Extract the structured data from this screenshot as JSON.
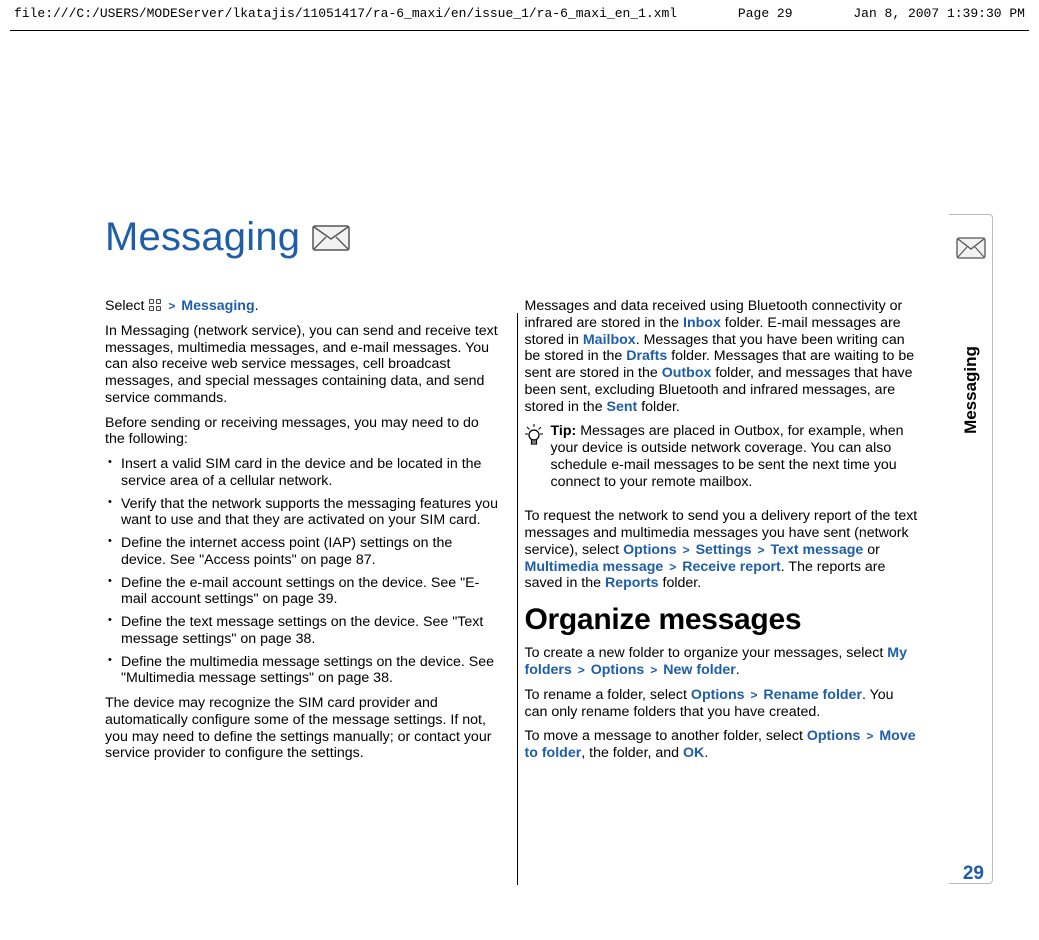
{
  "header": {
    "path": "file:///C:/USERS/MODEServer/lkatajis/11051417/ra-6_maxi/en/issue_1/ra-6_maxi_en_1.xml",
    "page": "Page 29",
    "timestamp": "Jan 8, 2007 1:39:30 PM"
  },
  "title": "Messaging",
  "side_tab": "Messaging",
  "page_number": "29",
  "colL": {
    "intro_prefix": "Select ",
    "intro_messaging": "Messaging",
    "p1": "In Messaging (network service), you can send and receive text messages, multimedia messages, and e-mail messages. You can also receive web service messages, cell broadcast messages, and special messages containing data, and send service commands.",
    "p2": "Before sending or receiving messages, you may need to do the following:",
    "li1": "Insert a valid SIM card in the device and be located in the service area of a cellular network.",
    "li2": "Verify that the network supports the messaging features you want to use and that they are activated on your SIM card.",
    "li3": "Define the internet access point (IAP) settings on the device. See \"Access points\" on page 87.",
    "li4": "Define the e-mail account settings on the device. See \"E-mail account settings\" on page 39.",
    "li5": "Define the text message settings on the device. See \"Text message settings\" on page 38.",
    "li6": "Define the multimedia message settings on the device. See \"Multimedia message settings\" on page 38.",
    "p3": "The device may recognize the SIM card provider and automatically configure some of the message settings. If not, you may need to define the settings manually; or contact your service provider to configure the settings."
  },
  "colR": {
    "p1a": "Messages and data received using Bluetooth connectivity or infrared are stored in the ",
    "inbox": "Inbox",
    "p1b": " folder. E-mail messages are stored in ",
    "mailbox": "Mailbox",
    "p1c": ". Messages that you have been writing can be stored in the ",
    "drafts": "Drafts",
    "p1d": " folder. Messages that are waiting to be sent are stored in the ",
    "outbox": "Outbox",
    "p1e": " folder, and messages that have been sent, excluding Bluetooth and infrared messages, are stored in the ",
    "sent": "Sent",
    "p1f": " folder.",
    "tip_label": "Tip:",
    "tip_body": " Messages are placed in Outbox, for example, when your device is outside network coverage. You can also schedule e-mail messages to be sent the next time you connect to your remote mailbox.",
    "p2a": "To request the network to send you a delivery report of the text messages and multimedia messages you have sent (network service), select ",
    "options": "Options",
    "settings": "Settings",
    "textmsg": "Text message",
    "or": " or ",
    "mms": "Multimedia message",
    "receive": "Receive report",
    "p2b": ". The reports are saved in the ",
    "reports": "Reports",
    "p2c": " folder.",
    "h2": "Organize messages",
    "p3a": "To create a new folder to organize your messages, select ",
    "myfolders": "My folders",
    "newfolder": "New folder",
    "p4a": "To rename a folder, select ",
    "rename": "Rename folder",
    "p4b": ". You can only rename folders that you have created.",
    "p5a": "To move a message to another folder, select ",
    "move": "Move to folder",
    "p5b": ", the folder, and ",
    "ok": "OK",
    "period": "."
  }
}
